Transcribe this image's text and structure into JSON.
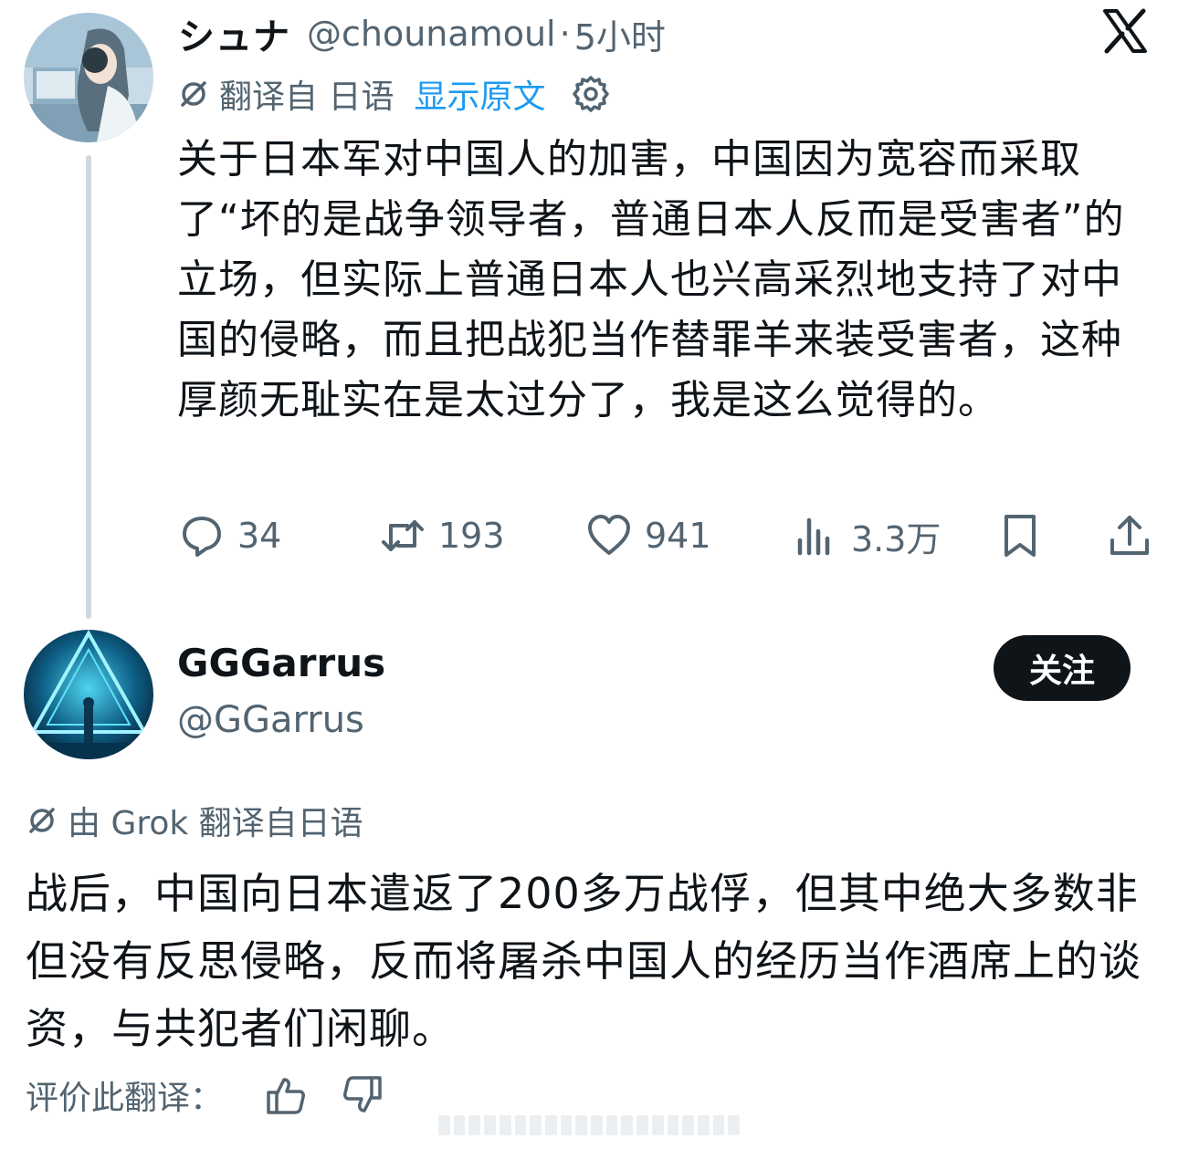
{
  "tweet1": {
    "author_name": "シュナ",
    "handle": "@chounamoul",
    "separator": "·",
    "time": "5小时",
    "translation_label": "翻译自 日语",
    "show_original_label": "显示原文",
    "text": "关于日本军对中国人的加害，中国因为宽容而采取了“坏的是战争领导者，普通日本人反而是受害者”的立场，但实际上普通日本人也兴高采烈地支持了对中国的侵略，而且把战犯当作替罪羊来装受害者，这种厚颜无耻实在是太过分了，我是这么觉得的。",
    "stats": {
      "replies": "34",
      "retweets": "193",
      "likes": "941",
      "views": "3.3万"
    }
  },
  "tweet2": {
    "author_name": "GGGarrus",
    "handle": "@GGarrus",
    "follow_label": "关注",
    "translation_label": "由 Grok 翻译自日语",
    "text": "战后，中国向日本遣返了200多万战俘，但其中绝大多数非但没有反思侵略，反而将屠杀中国人的经历当作酒席上的谈资，与共犯者们闲聊。",
    "rate_label": "评价此翻译："
  },
  "icons": {
    "x_logo": "x-logo-icon",
    "translate": "translate-icon",
    "settings": "gear-icon",
    "reply": "reply-icon",
    "retweet": "retweet-icon",
    "like": "heart-icon",
    "views": "views-icon",
    "bookmark": "bookmark-icon",
    "share": "share-icon",
    "thumb_up": "thumb-up-icon",
    "thumb_down": "thumb-down-icon"
  },
  "colors": {
    "text": "#0f1419",
    "secondary": "#536471",
    "link": "#1d9bf0",
    "thread_line": "#cfd9de",
    "follow_bg": "#0f1419"
  }
}
